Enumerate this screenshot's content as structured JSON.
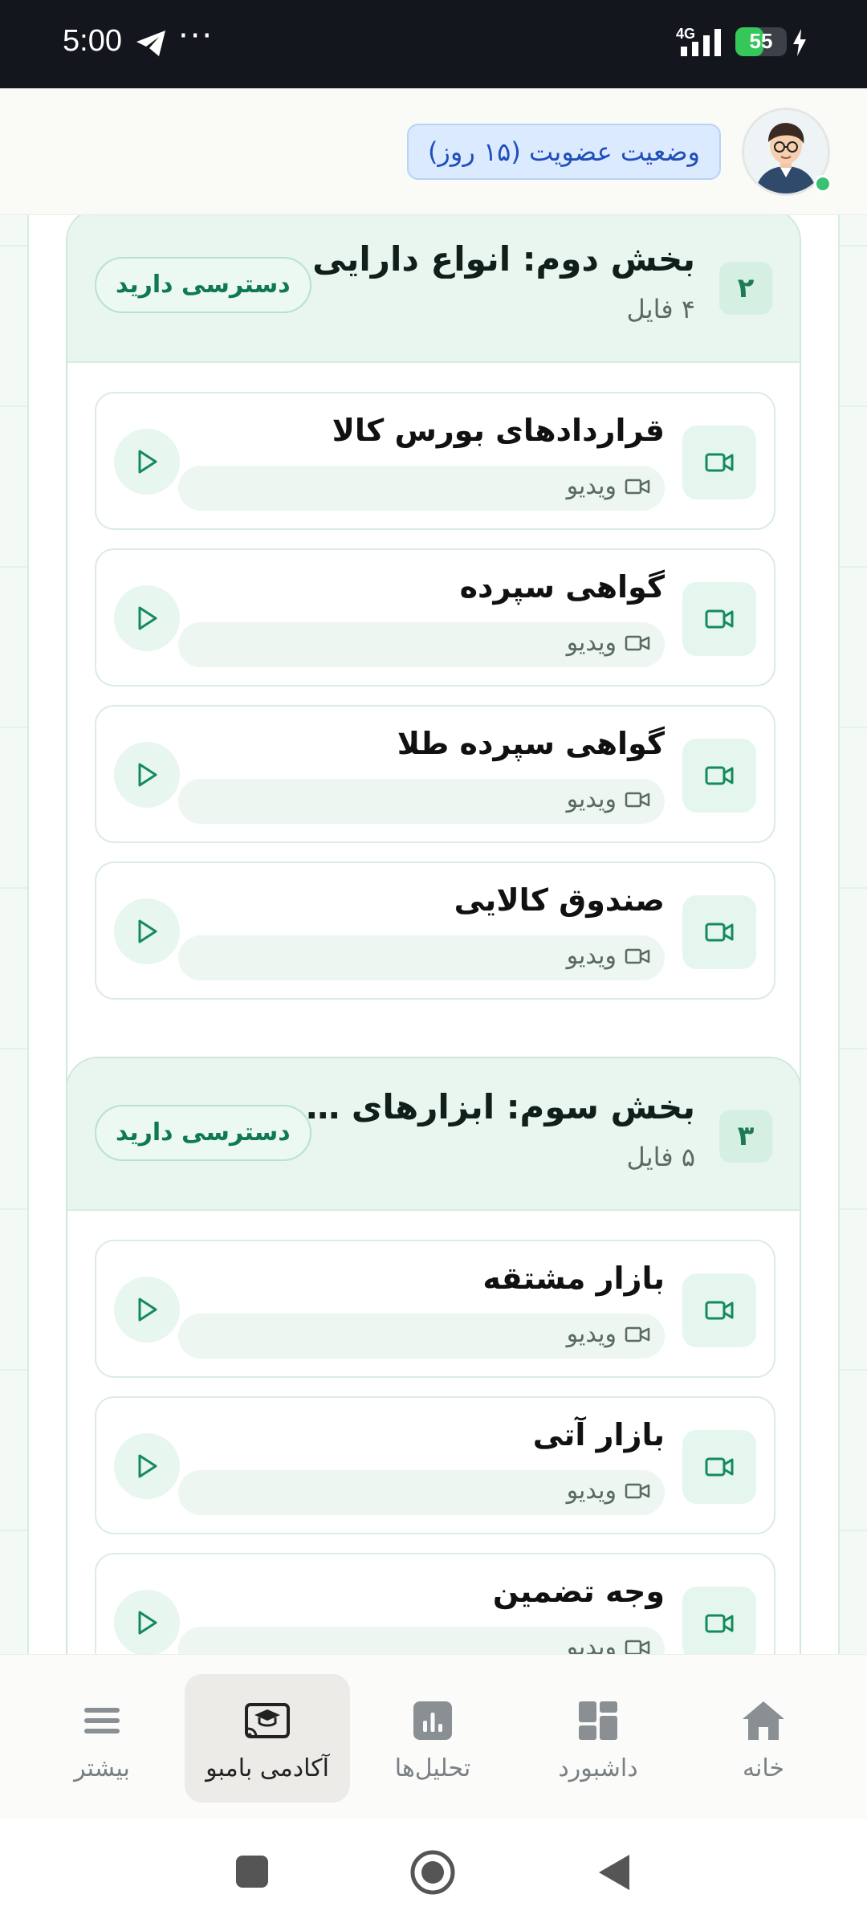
{
  "status_bar": {
    "time": "5:00",
    "dots": "···",
    "network": "4G",
    "battery": "55",
    "battery_level": 0.55
  },
  "header": {
    "membership_status": "وضعیت عضویت (۱۵ روز)",
    "avatar_icon": "user-avatar"
  },
  "sections": [
    {
      "number": "۲",
      "title": "بخش دوم: انواع دارایی",
      "file_count": "۴ فایل",
      "access": "دسترسی دارید",
      "items": [
        {
          "title": "قراردادهای بورس کالا",
          "type": "ویدیو"
        },
        {
          "title": "گواهی سپرده",
          "type": "ویدیو"
        },
        {
          "title": "گواهی سپرده طلا",
          "type": "ویدیو"
        },
        {
          "title": "صندوق کالایی",
          "type": "ویدیو"
        }
      ]
    },
    {
      "number": "۳",
      "title": "بخش سوم: ابزارهای م...",
      "file_count": "۵ فایل",
      "access": "دسترسی دارید",
      "items": [
        {
          "title": "بازار مشتقه",
          "type": "ویدیو"
        },
        {
          "title": "بازار آتی",
          "type": "ویدیو"
        },
        {
          "title": "وجه تضمین",
          "type": "ویدیو"
        }
      ]
    }
  ],
  "bottom_nav": {
    "items": [
      {
        "label": "بیشتر",
        "icon": "menu-icon",
        "active": false
      },
      {
        "label": "آکادمی بامبو",
        "icon": "academy-cast-icon",
        "active": true
      },
      {
        "label": "تحلیل‌ها",
        "icon": "chart-icon",
        "active": false
      },
      {
        "label": "داشبورد",
        "icon": "dashboard-icon",
        "active": false
      },
      {
        "label": "خانه",
        "icon": "home-icon",
        "active": false
      }
    ]
  },
  "colors": {
    "accent": "#0f7a52",
    "section_header_bg": "#e8f6ef",
    "membership_bg": "#dbeafe"
  }
}
